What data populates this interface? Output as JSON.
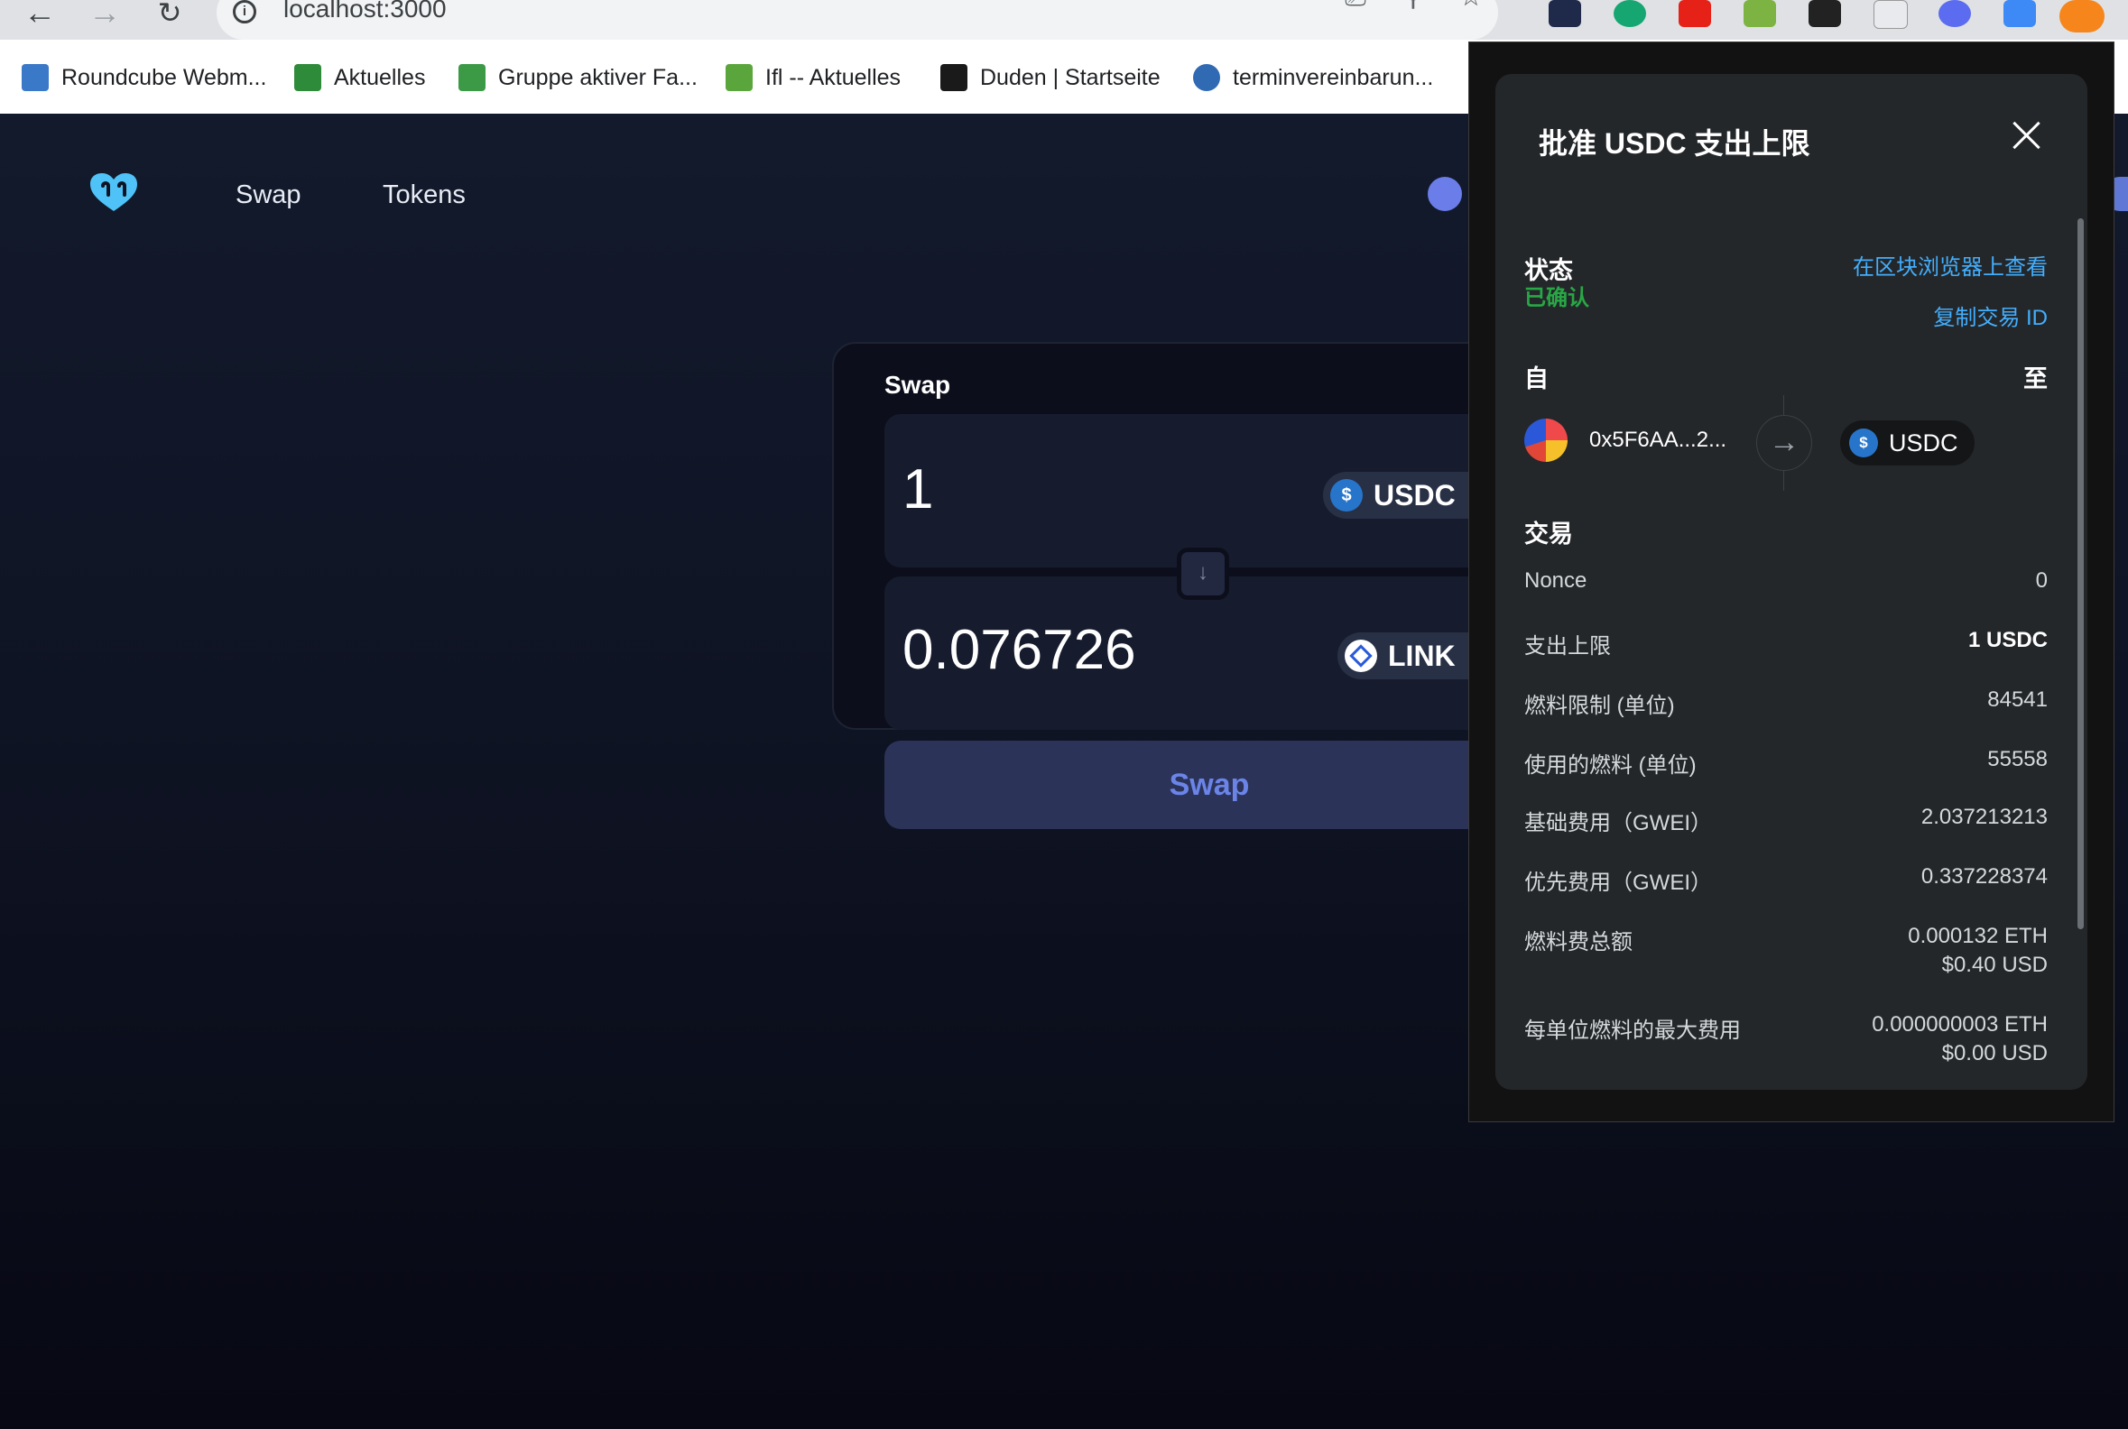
{
  "browser": {
    "url": "localhost:3000",
    "bookmarks": [
      {
        "label": "Roundcube Webm...",
        "color": "#3a78c8"
      },
      {
        "label": "Aktuelles",
        "color": "#2e8b3a"
      },
      {
        "label": "Gruppe aktiver Fa...",
        "color": "#3c9a47"
      },
      {
        "label": "Ifl -- Aktuelles",
        "color": "#5aa63c"
      },
      {
        "label": "Duden | Startseite",
        "color": "#1a1a1a"
      },
      {
        "label": "terminvereinbarun...",
        "color": "#2f6ab3"
      }
    ],
    "extension_icons": [
      "shield-icon",
      "grammarly-icon",
      "youtube-icon",
      "plant-icon",
      "bear-icon",
      "document-icon",
      "gear-flower-icon",
      "stack-icon",
      "metamask-fox-icon"
    ]
  },
  "app": {
    "nav": {
      "swap": "Swap",
      "tokens": "Tokens"
    },
    "swap_card": {
      "title": "Swap",
      "from_amount": "1",
      "from_token": "USDC",
      "to_amount": "0.076726",
      "to_token": "LINK",
      "submit_label": "Swap"
    }
  },
  "popup": {
    "title": "批准 USDC 支出上限",
    "status_label": "状态",
    "status_value": "已确认",
    "view_on_explorer": "在区块浏览器上查看",
    "copy_tx_id": "复制交易 ID",
    "from_label": "自",
    "to_label": "至",
    "from_address": "0x5F6AA...2...",
    "to_token": "USDC",
    "tx_header": "交易",
    "details": [
      {
        "label": "Nonce",
        "value": "0"
      },
      {
        "label": "支出上限",
        "value": "1 USDC"
      },
      {
        "label": "燃料限制 (单位)",
        "value": "84541"
      },
      {
        "label": "使用的燃料 (单位)",
        "value": "55558"
      },
      {
        "label": "基础费用（GWEI）",
        "value": "2.037213213"
      },
      {
        "label": "优先费用（GWEI）",
        "value": "0.337228374"
      },
      {
        "label": "燃料费总额",
        "value": "0.000132 ETH",
        "value2": "$0.40 USD"
      },
      {
        "label": "每单位燃料的最大费用",
        "value": "0.000000003 ETH",
        "value2": "$0.00 USD"
      }
    ]
  },
  "colors": {
    "accent_blue": "#43aefc",
    "success_green": "#28a745",
    "swap_button_text": "#6b84e8",
    "app_logo": "#4fc3f7"
  }
}
